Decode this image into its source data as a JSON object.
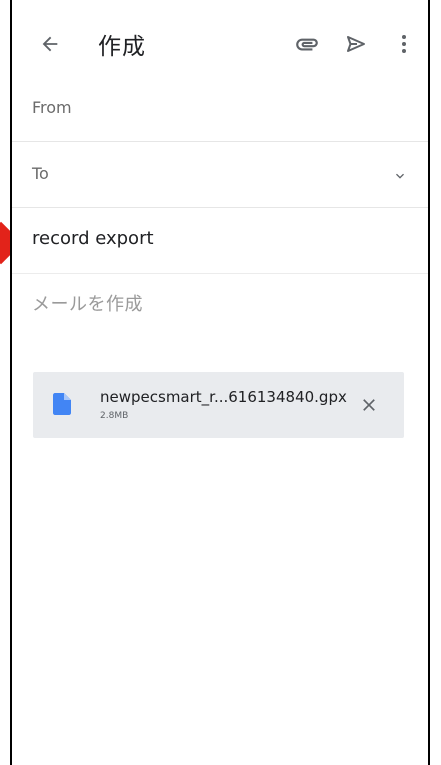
{
  "toolbar": {
    "title": "作成",
    "back_icon": "arrow-back-icon",
    "attach_icon": "paperclip-icon",
    "send_icon": "send-icon",
    "more_icon": "more-vert-icon"
  },
  "from": {
    "label": "From"
  },
  "to": {
    "label": "To",
    "expand_icon": "chevron-down-icon"
  },
  "subject": {
    "value": "record export"
  },
  "body": {
    "placeholder": "メールを作成"
  },
  "attachment": {
    "file_name": "newpecsmart_r...616134840.gpx",
    "file_size": "2.8MB",
    "file_icon": "document-icon",
    "remove_icon": "close-icon"
  },
  "colors": {
    "file_icon": "#4285f4",
    "attachment_bg": "#e9ebee",
    "pointer_marker": "#e2231a"
  }
}
